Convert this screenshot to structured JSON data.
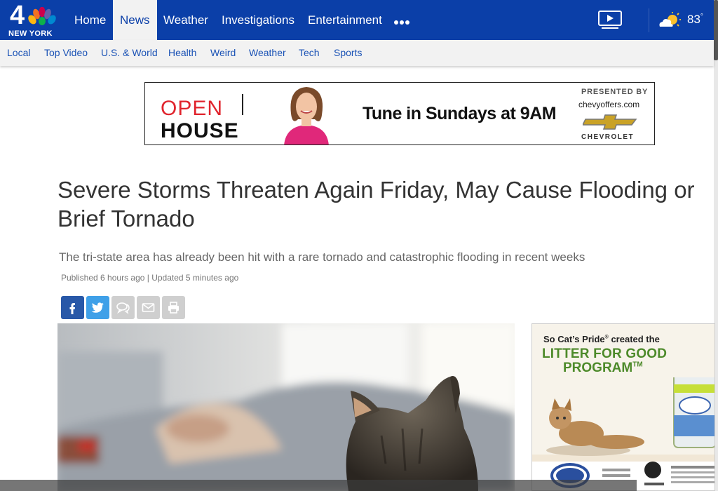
{
  "brand": {
    "logo_number": "4",
    "logo_city": "NEW YORK"
  },
  "nav": {
    "items": [
      "Home",
      "News",
      "Weather",
      "Investigations",
      "Entertainment"
    ],
    "active": "News",
    "more_icon": "more-dots-icon",
    "video_icon": "video-icon",
    "weather_icon": "partly-cloudy-icon",
    "temperature": "83",
    "temperature_unit": "°"
  },
  "subnav": {
    "items": [
      "Local",
      "Top Video",
      "U.S. & World",
      "Health",
      "Weird",
      "Weather",
      "Tech",
      "Sports"
    ]
  },
  "ad_banner": {
    "open": "OPEN",
    "house": "HOUSE",
    "tagline": "Tune in Sundays at 9AM",
    "presented_by": "PRESENTED BY",
    "site": "chevyoffers.com",
    "sponsor": "CHEVROLET"
  },
  "article": {
    "headline": "Severe Storms Threaten Again Friday, May Cause Flooding or Brief Tornado",
    "deck": "The tri-state area has already been hit with a rare tornado and catastrophic flooding in recent weeks",
    "published": "Published 6 hours ago | Updated 5 minutes ago"
  },
  "share": {
    "buttons": [
      "facebook-icon",
      "twitter-icon",
      "comment-icon",
      "email-icon",
      "print-icon"
    ]
  },
  "side_ad": {
    "intro": "So Cat’s Pride",
    "intro_mark": "®",
    "intro_rest": " created the",
    "title_line1": "LITTER FOR GOOD",
    "title_line2": "PROGRAM",
    "title_mark": "TM"
  },
  "colors": {
    "nav_blue": "#0b3fa8",
    "link_blue": "#1a52b5",
    "facebook": "#2858a8",
    "twitter": "#3fa0e8",
    "ad_red": "#e0242d",
    "ad_green": "#4d8a2a"
  }
}
